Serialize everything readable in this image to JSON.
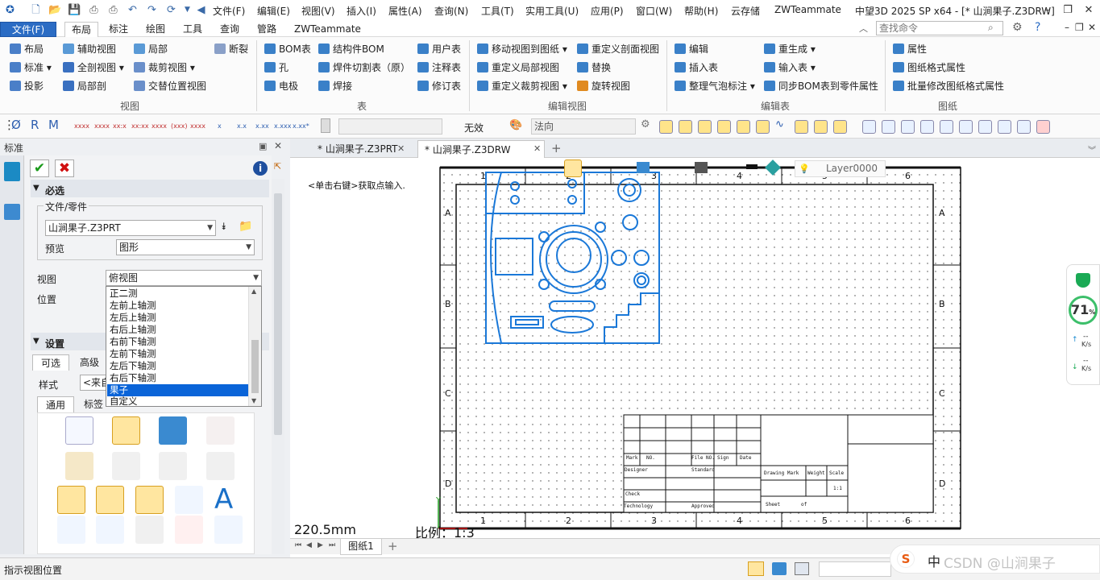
{
  "app": {
    "title": "中望3D 2025 SP x64 - [* 山涧果子.Z3DRW]",
    "menus": [
      "文件(F)",
      "编辑(E)",
      "视图(V)",
      "插入(I)",
      "属性(A)",
      "查询(N)",
      "工具(T)",
      "实用工具(U)",
      "应用(P)",
      "窗口(W)",
      "帮助(H)",
      "云存储",
      "ZWTeammate"
    ]
  },
  "ribbon_tabs": [
    "文件(F)",
    "布局",
    "标注",
    "绘图",
    "工具",
    "查询",
    "管路",
    "ZWTeammate"
  ],
  "search": {
    "placeholder": "查找命令"
  },
  "ribbon": {
    "groups": [
      {
        "label": "视图",
        "items": [
          "布局",
          "辅助视图",
          "局部",
          "断裂",
          "标准",
          "全剖视图",
          "裁剪视图",
          "投影",
          "局部剖",
          "交替位置视图"
        ]
      },
      {
        "label": "表",
        "items": [
          "BOM表",
          "结构件BOM",
          "用户表",
          "孔",
          "焊件切割表（原）",
          "注释表",
          "电极",
          "焊接",
          "修订表"
        ]
      },
      {
        "label": "编辑视图",
        "items": [
          "移动视图到图纸",
          "重定义剖面视图",
          "重定义局部视图",
          "替换",
          "重定义裁剪视图",
          "旋转视图"
        ]
      },
      {
        "label": "编辑表",
        "items": [
          "编辑",
          "重生成",
          "插入表",
          "输入表",
          "整理气泡标注",
          "同步BOM表到零件属性"
        ]
      },
      {
        "label": "图纸",
        "items": [
          "属性",
          "图纸格式属性",
          "批量修改图纸格式属性"
        ]
      }
    ]
  },
  "toolbar2": {
    "status": "无效",
    "dir_placeholder": "法向"
  },
  "panel": {
    "title": "标准",
    "required": "必选",
    "file_part": "文件/零件",
    "file_value": "山涧果子.Z3PRT",
    "preview_label": "预览",
    "preview_value": "图形",
    "view_label": "视图",
    "view_value": "俯视图",
    "position_label": "位置",
    "dropdown": [
      "正二测",
      "左前上轴测",
      "左后上轴测",
      "右后上轴测",
      "右前下轴测",
      "左前下轴测",
      "左后下轴测",
      "右后下轴测",
      "果子",
      "自定义"
    ],
    "selected_index": 8,
    "settings": "设置",
    "tab_optional": "可选",
    "tab_advanced": "高级",
    "style_label": "样式",
    "style_value": "<来自",
    "tab_general": "通用",
    "tab_label": "标签"
  },
  "doc_tabs": [
    "* 山涧果子.Z3PRT",
    "* 山涧果子.Z3DRW"
  ],
  "canvas": {
    "hint": "<单击右键>获取点输入.",
    "layer": "Layer0000",
    "length": "220.5mm",
    "scale": "比例：1:3",
    "cols": [
      "1",
      "2",
      "3",
      "4",
      "5",
      "6"
    ],
    "rows": [
      "A",
      "B",
      "C",
      "D"
    ],
    "titleblock": {
      "mark": "Mark",
      "no": "NO.",
      "file_no": "File NO.",
      "sign": "Sign",
      "date": "Date",
      "designer": "Designer",
      "standard": "Standard",
      "check": "Check",
      "technology": "Technology",
      "approved": "Approved",
      "drawing_mark": "Drawing Mark",
      "weight": "Weight",
      "scale_h": "Scale",
      "scale_v": "1:1",
      "sheet": "Sheet",
      "of": "of"
    }
  },
  "sheet_tab": "图纸1",
  "status_text": "指示视图位置",
  "side_widget": {
    "percent": "71",
    "unit": "%",
    "up": "--",
    "up_unit": "K/s",
    "down": "--",
    "down_unit": "K/s"
  },
  "csdn": {
    "text": "CSDN @山涧果子",
    "ime": "中"
  }
}
